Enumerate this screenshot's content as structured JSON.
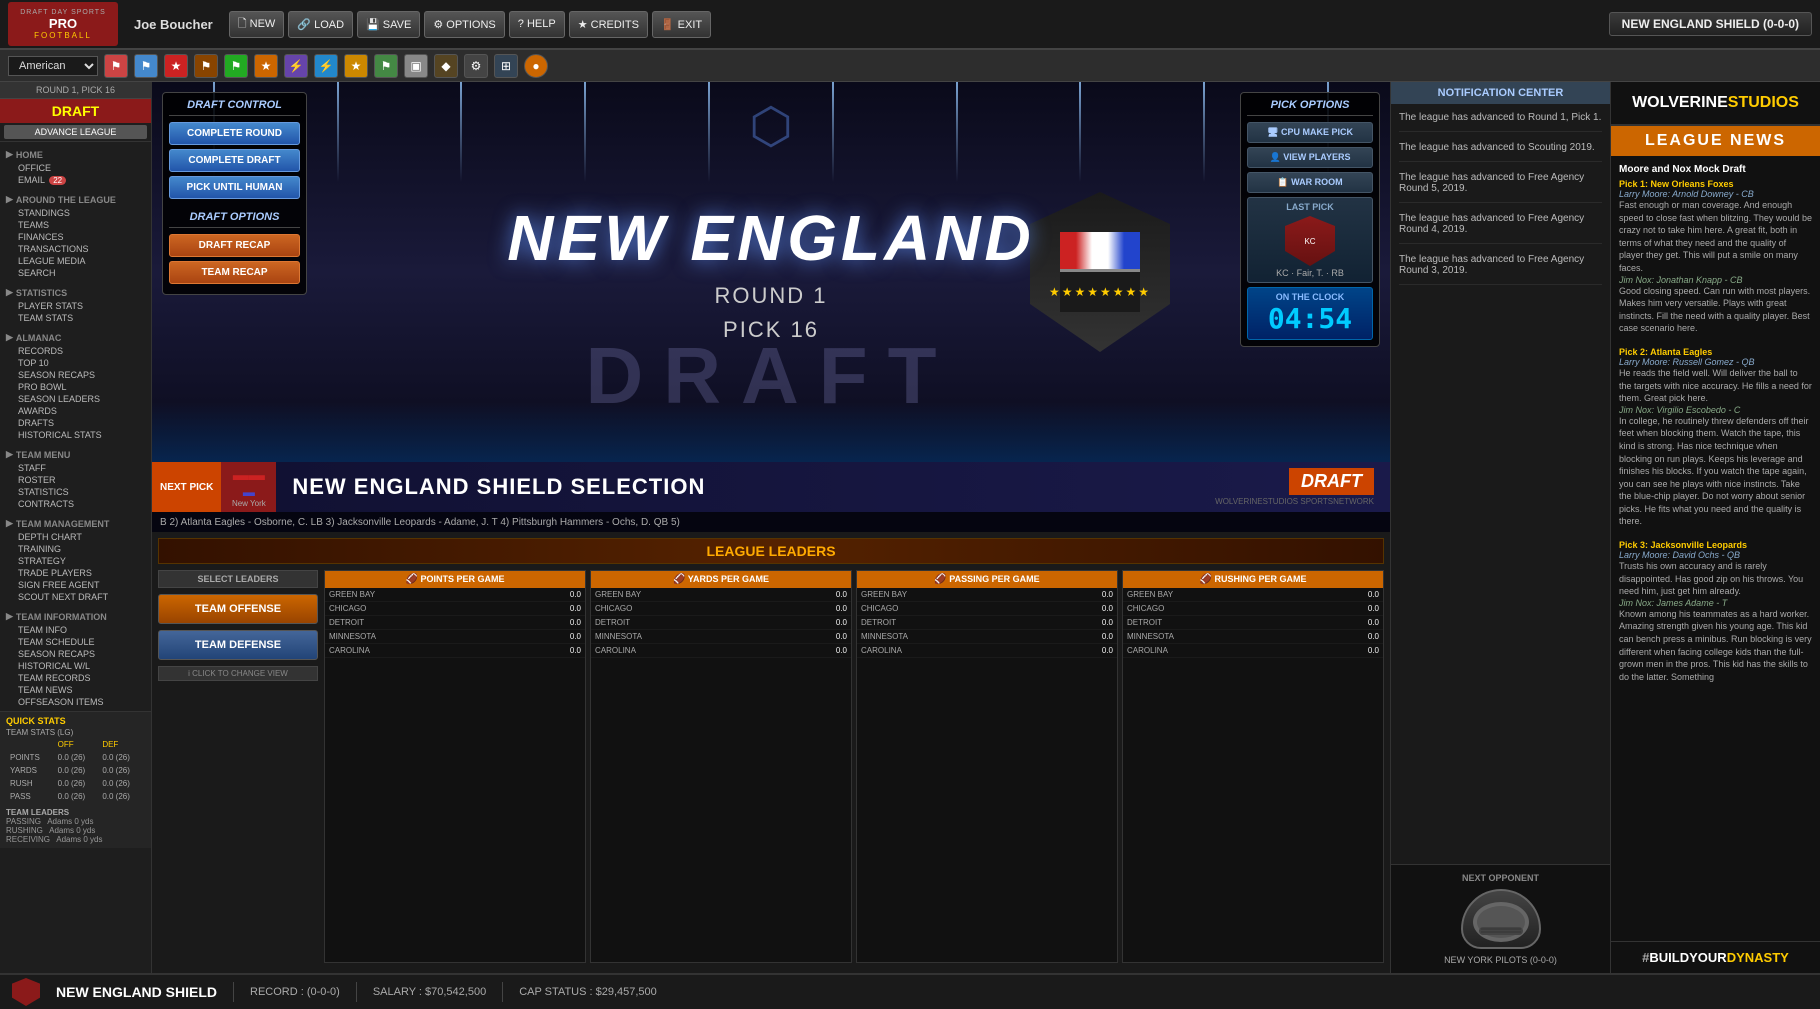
{
  "app": {
    "title": "DRAFT DAY SPORTS PRO FOOTBALL",
    "logo_top": "DRAFT DAY SPORTS",
    "logo_main": "PRO",
    "logo_sub": "FOOTBALL",
    "user": "Joe Boucher",
    "team_badge": "NEW ENGLAND SHIELD (0-0-0)"
  },
  "nav": {
    "new": "🗋 NEW",
    "load": "🔗 LOAD",
    "save": "💾 SAVE",
    "options": "⚙ OPTIONS",
    "help": "? HELP",
    "credits": "★ CREDITS",
    "exit": "🚪 EXIT"
  },
  "round_info": {
    "round": "ROUND 1, PICK 16",
    "draft_label": "DRAFT",
    "advance_label": "ADVANCE LEAGUE"
  },
  "sidebar": {
    "home_label": "HOME",
    "office_label": "OFFICE",
    "email_label": "EMAIL",
    "email_badge": "22",
    "around_league": "AROUND THE LEAGUE",
    "standings": "STANDINGS",
    "teams": "TEAMS",
    "finances": "FINANCES",
    "transactions": "TRANSACTIONS",
    "league_media": "LEAGUE MEDIA",
    "search": "SEARCH",
    "statistics": "STATISTICS",
    "player_stats": "PLAYER STATS",
    "team_stats": "TEAM STATS",
    "almanac": "ALMANAC",
    "records": "RECORDS",
    "top_10": "TOP 10",
    "season_recaps": "SEASON RECAPS",
    "pro_bowl": "PRO BOWL",
    "season_leaders": "SEASON LEADERS",
    "awards": "AWARDS",
    "drafts": "DRAFTS",
    "historical_stats": "HISTORICAL STATS",
    "team_menu": "TEAM MENU",
    "staff": "STAFF",
    "roster": "ROSTER",
    "statistics_tm": "STATISTICS",
    "contracts": "CONTRACTS",
    "team_management": "TEAM MANAGEMENT",
    "depth_chart": "DEPTH CHART",
    "training": "TRAINING",
    "strategy": "STRATEGY",
    "trade_players": "TRADE PLAYERS",
    "sign_free_agent": "SIGN FREE AGENT",
    "scout_next_draft": "SCOUT NEXT DRAFT",
    "team_information": "TEAM INFORMATION",
    "team_info": "TEAM INFO",
    "team_schedule": "TEAM SCHEDULE",
    "season_recaps_ti": "SEASON RECAPS",
    "historical_wl": "HISTORICAL W/L",
    "team_records": "TEAM RECORDS",
    "team_news": "TEAM NEWS",
    "offseason_items": "OFFSEASON ITEMS",
    "quick_stats": "QUICK STATS",
    "team_stats_label": "TEAM STATS (LG)",
    "off_label": "OFF",
    "def_label": "DEF",
    "points_label": "POINTS",
    "points_off": "0.0 (26)",
    "points_def": "0.0 (26)",
    "yards_label": "YARDS",
    "yards_off": "0.0 (26)",
    "yards_def": "0.0 (26)",
    "rush_label": "RUSH",
    "rush_off": "0.0 (26)",
    "rush_def": "0.0 (26)",
    "pass_label": "PASS",
    "pass_off": "0.0 (26)",
    "pass_def": "0.0 (26)",
    "team_leaders_label": "TEAM LEADERS",
    "passing_label": "PASSING",
    "passing_val": "Adams 0 yds",
    "rushing_label": "RUSHING",
    "rushing_val": "Adams 0 yds",
    "receiving_label": "RECEIVING",
    "receiving_val": "Adams 0 yds"
  },
  "draft_control": {
    "title": "DRAFT CONTROL",
    "complete_round": "COMPLETE ROUND",
    "complete_draft": "COMPLETE DRAFT",
    "pick_until_human": "PICK UNTIL HUMAN",
    "options_title": "DRAFT OPTIONS",
    "draft_recap": "DRAFT RECAP",
    "team_recap": "TEAM RECAP"
  },
  "draft_stage": {
    "team_name": "NEW ENGLAND",
    "round_label": "ROUND 1",
    "pick_label": "PICK 16",
    "watermark": "DRAFT"
  },
  "pick_options": {
    "title": "PICK OPTIONS",
    "cpu_make_pick": "CPU MAKE PICK",
    "view_players": "VIEW PLAYERS",
    "war_room": "WAR ROOM",
    "last_pick_title": "LAST PICK",
    "last_pick_info": "KC · Fair, T. · RB",
    "on_clock_title": "ON THE CLOCK",
    "timer": "04:54"
  },
  "ticker": {
    "next_pick_label": "NEXT PICK",
    "team": "New York",
    "selection_title": "NEW ENGLAND SHIELD SELECTION",
    "draft_label": "DRAFT",
    "network": "WOLVERINESTUDIOS SPORTSNETWORK",
    "scroll_text": "B  2) Atlanta Eagles - Osborne, C. LB   3) Jacksonville Leopards - Adame, J. T   4) Pittsburgh Hammers - Ochs, D. QB   5)"
  },
  "league_leaders": {
    "title": "LEAGUE LEADERS",
    "select_label": "SELECT LEADERS",
    "team_offense": "TEAM OFFENSE",
    "team_defense": "TEAM DEFENSE",
    "change_view": "i CLICK TO CHANGE VIEW",
    "points_per_game": "POINTS PER GAME",
    "yards_per_game": "YARDS PER GAME",
    "passing_per_game": "PASSING PER GAME",
    "rushing_per_game": "RUSHING PER GAME",
    "teams": [
      "GREEN BAY",
      "CHICAGO",
      "DETROIT",
      "MINNESOTA",
      "CAROLINA"
    ],
    "stats": {
      "points": [
        "0.0",
        "0.0",
        "0.0",
        "0.0",
        "0.0"
      ],
      "yards": [
        "0.0",
        "0.0",
        "0.0",
        "0.0",
        "0.0"
      ],
      "passing": [
        "0.0",
        "0.0",
        "0.0",
        "0.0",
        "0.0"
      ],
      "rushing": [
        "0.0",
        "0.0",
        "0.0",
        "0.0",
        "0.0"
      ]
    }
  },
  "notification_center": {
    "title": "NOTIFICATION CENTER",
    "notifications": [
      "The league has advanced to Round 1, Pick 1.",
      "The league has advanced to Scouting 2019.",
      "The league has advanced to Free Agency Round 5, 2019.",
      "The league has advanced to Free Agency Round 4, 2019.",
      "The league has advanced to Free Agency Round 3, 2019."
    ]
  },
  "next_opponent": {
    "title": "NEXT OPPONENT",
    "name": "NEW YORK PILOTS (0-0-0)"
  },
  "league_news": {
    "brand": "WOLVERINESTUDIOS",
    "brand_white": "WOLVERINE",
    "brand_gold": "STUDIOS",
    "banner": "LEAGUE NEWS",
    "items": [
      {
        "title": "Moore and Nox Mock Draft",
        "pick": "Pick 1: New Orleans Foxes",
        "player": "Larry Moore: Arnold Downey - CB",
        "text": "Fast enough or man coverage. And enough speed to close fast when blitzing. They would be crazy not to take him here. A great fit, both in terms of what they need and the quality of player they get. This will put a smile on many faces.",
        "analyst": "Jim Nox: Jonathan Knapp - CB",
        "analyst_text": "Good closing speed. Can run with most players. Makes him very versatile. Plays with great instincts. Fill the need with a quality player. Best case scenario here."
      },
      {
        "pick": "Pick 2: Atlanta Eagles",
        "player": "Larry Moore: Russell Gomez - QB",
        "text": "He reads the field well. Will deliver the ball to the targets with nice accuracy. He fills a need for them. Great pick here.",
        "analyst": "Jim Nox: Virgilio Escobedo - C",
        "analyst_text": "In college, he routinely threw defenders off their feet when blocking them. Watch the tape, this kind is strong. Has nice technique when blocking on run plays. Keeps his leverage and finishes his blocks. If you watch the tape again, you can see he plays with nice instincts. Take the blue-chip player. Do not worry about senior picks. He fits what you need and the quality is there."
      },
      {
        "pick": "Pick 3: Jacksonville Leopards",
        "player": "Larry Moore: David Ochs - QB",
        "text": "Trusts his own accuracy and is rarely disappointed. Has good zip on his throws. You need him, just get him already.",
        "analyst": "Jim Nox: James Adame - T",
        "analyst_text": "Known among his teammates as a hard worker. Amazing strength given his young age. This kid can bench press a minibus. Run blocking is very different when facing college kids than the full-grown men in the pros. This kid has the skills to do the latter. Something"
      }
    ],
    "hashtag": "#BUILDYOURDYNASTY",
    "build": "#BUILD",
    "your": "YOUR",
    "dynasty": "DYNASTY"
  },
  "status_bar": {
    "team": "NEW ENGLAND SHIELD",
    "record": "RECORD : (0-0-0)",
    "salary": "SALARY : $70,542,500",
    "cap_status": "CAP STATUS : $29,457,500"
  },
  "league_select": "American",
  "icons": {
    "team_colors": [
      "#cc4400",
      "#8B1A1A",
      "#004488",
      "#446622",
      "#cc6600"
    ]
  }
}
